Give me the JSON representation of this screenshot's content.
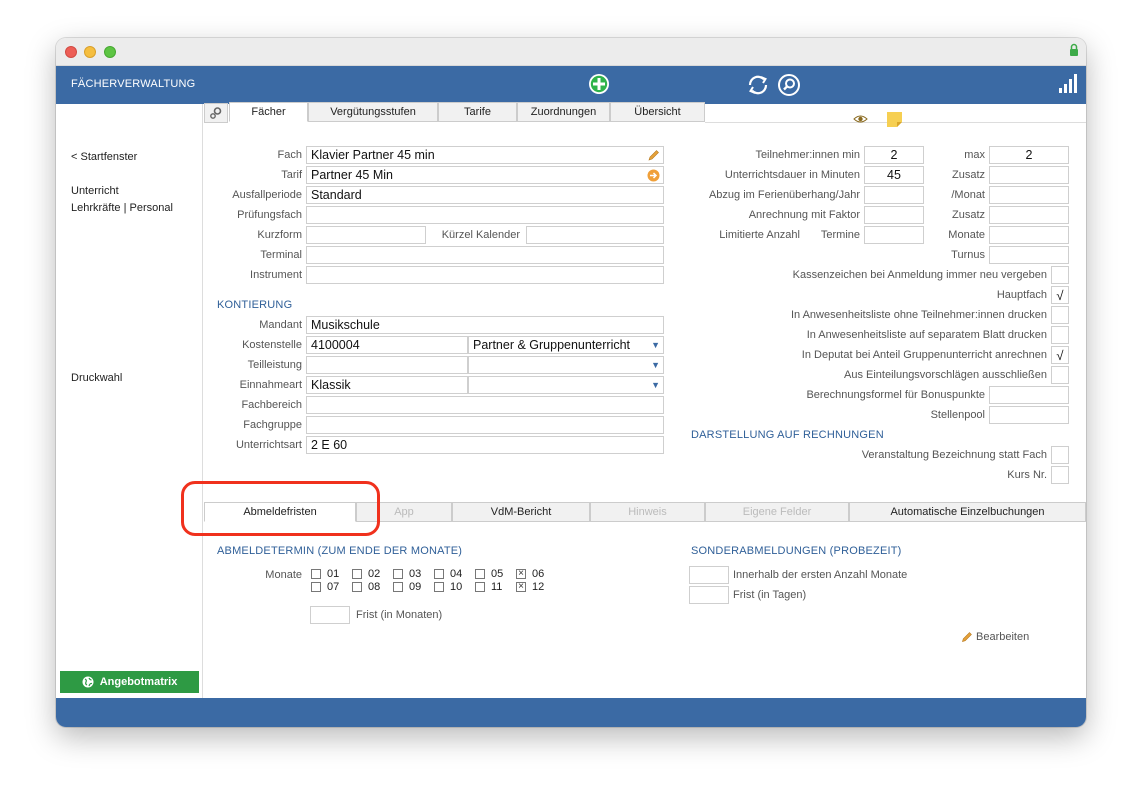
{
  "app": {
    "title": "FÄCHERVERWALTUNG"
  },
  "icons": {
    "add": "plus-circle-icon",
    "refresh": "refresh-icon",
    "search": "search-icon",
    "signal": "signal-bars-icon"
  },
  "sidebar": {
    "back": "< Startfenster",
    "unterricht": "Unterricht",
    "lehrkraefte": "Lehrkräfte | Personal",
    "druckwahl": "Druckwahl",
    "angebot_button": "Angebotmatrix"
  },
  "tabs": [
    "Fächer",
    "Vergütungsstufen",
    "Tarife",
    "Zuordnungen",
    "Übersicht"
  ],
  "left_form": {
    "fach_label": "Fach",
    "fach_value": "Klavier Partner 45 min",
    "tarif_label": "Tarif",
    "tarif_value": "Partner 45 Min",
    "ausfall_label": "Ausfallperiode",
    "ausfall_value": "Standard",
    "pruefung_label": "Prüfungsfach",
    "kurzform_label": "Kurzform",
    "kuerzel_label": "Kürzel Kalender",
    "terminal_label": "Terminal",
    "instrument_label": "Instrument"
  },
  "kontierung": {
    "heading": "KONTIERUNG",
    "mandant_label": "Mandant",
    "mandant_value": "Musikschule",
    "kostenstelle_label": "Kostenstelle",
    "kostenstelle_value": "4100004",
    "kostenstelle_select": "Partner & Gruppenunterricht",
    "teilleistung_label": "Teilleistung",
    "einnahmeart_label": "Einnahmeart",
    "einnahmeart_value": "Klassik",
    "fachbereich_label": "Fachbereich",
    "fachgruppe_label": "Fachgruppe",
    "unterrichtsart_label": "Unterrichtsart",
    "unterrichtsart_value": "2 E 60"
  },
  "right_form": {
    "teilnehmer_min_label": "Teilnehmer:innen min",
    "teilnehmer_min_value": "2",
    "max_label": "max",
    "max_value": "2",
    "dauer_label": "Unterrichtsdauer in Minuten",
    "dauer_value": "45",
    "zusatz_label": "Zusatz",
    "abzug_label": "Abzug im Ferienüberhang/Jahr",
    "monat_label": "/Monat",
    "anrechnung_label": "Anrechnung mit Faktor",
    "zusatz2_label": "Zusatz",
    "limitiert_label": "Limitierte Anzahl",
    "termine_label": "Termine",
    "monate_label": "Monate",
    "turnus_label": "Turnus",
    "kassenzeichen_label": "Kassenzeichen bei Anmeldung immer neu vergeben",
    "hauptfach_label": "Hauptfach",
    "hauptfach_mark": "√",
    "anwesenheit1_label": "In Anwesenheitsliste ohne Teilnehmer:innen drucken",
    "anwesenheit2_label": "In Anwesenheitsliste auf separatem Blatt drucken",
    "deputat_label": "In Deputat bei Anteil Gruppenunterricht anrechnen",
    "deputat_mark": "√",
    "einteilung_label": "Aus Einteilungsvorschlägen ausschließen",
    "bonus_label": "Berechnungsformel für Bonuspunkte",
    "stellenpool_label": "Stellenpool",
    "darstellung_heading": "DARSTELLUNG AUF RECHNUNGEN",
    "veranstaltung_label": "Veranstaltung Bezeichnung statt Fach",
    "kurs_label": "Kurs Nr."
  },
  "bottom_tabs": [
    "Abmeldefristen",
    "App",
    "VdM-Bericht",
    "Hinweis",
    "Eigene Felder",
    "Automatische Einzelbuchungen"
  ],
  "abmeldung": {
    "heading": "ABMELDETERMIN (ZUM ENDE DER MONATE)",
    "monate_label": "Monate",
    "months": [
      "01",
      "02",
      "03",
      "04",
      "05",
      "06",
      "07",
      "08",
      "09",
      "10",
      "11",
      "12"
    ],
    "checked_mark": "×",
    "frist_label": "Frist (in Monaten)"
  },
  "sonder": {
    "heading": "SONDERABMELDUNGEN (PROBEZEIT)",
    "innerhalb_label": "Innerhalb der ersten Anzahl Monate",
    "frist_tage_label": "Frist (in Tagen)",
    "edit_label": "Bearbeiten"
  },
  "colors": {
    "appbar": "#3b6aa4",
    "section": "#2f5f98",
    "green_button": "#2e9a44",
    "annotation": "#f0311d"
  }
}
